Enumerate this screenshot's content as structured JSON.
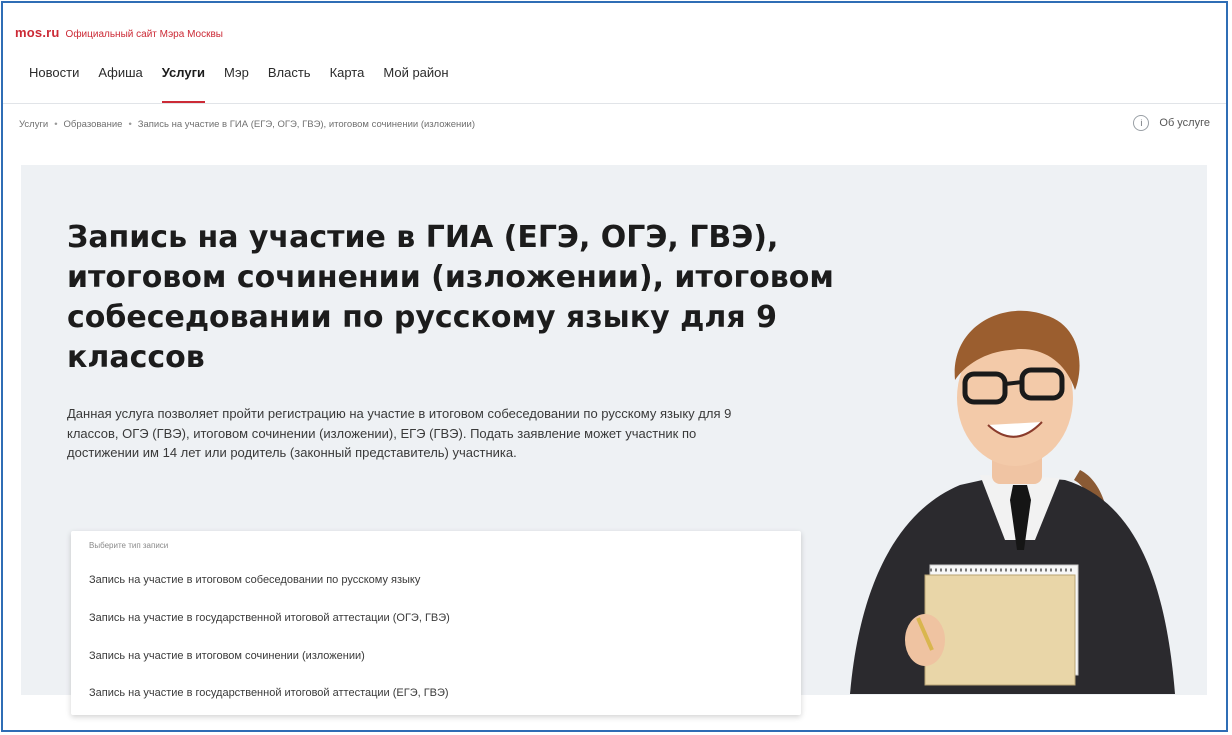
{
  "header": {
    "logo": "mos.ru",
    "tagline": "Официальный сайт Мэра Москвы",
    "nav": [
      {
        "label": "Новости"
      },
      {
        "label": "Афиша"
      },
      {
        "label": "Услуги",
        "active": true
      },
      {
        "label": "Мэр"
      },
      {
        "label": "Власть"
      },
      {
        "label": "Карта"
      },
      {
        "label": "Мой район"
      }
    ]
  },
  "breadcrumb": [
    "Услуги",
    "Образование",
    "Запись на участие в ГИА (ЕГЭ, ОГЭ, ГВЭ), итоговом сочинении (изложении)"
  ],
  "about_label": "Об услуге",
  "about_icon": "info-icon",
  "hero": {
    "title": "Запись на участие в ГИА (ЕГЭ, ОГЭ, ГВЭ), итоговом сочинении (изложении), итоговом собеседовании по русскому языку для 9 классов",
    "description": "Данная услуга позволяет пройти регистрацию на участие в итоговом собеседовании по русскому языку для 9 классов, ОГЭ (ГВЭ), итоговом сочинении (изложении), ЕГЭ (ГВЭ). Подать заявление может участник по достижении им 14 лет или родитель (законный представитель) участника."
  },
  "dropdown": {
    "label": "Выберите тип записи",
    "options": [
      "Запись на участие в итоговом собеседовании по русскому языку",
      "Запись на участие в государственной итоговой аттестации (ОГЭ, ГВЭ)",
      "Запись на участие в итоговом сочинении (изложении)",
      "Запись на участие в государственной итоговой аттестации (ЕГЭ, ГВЭ)"
    ]
  },
  "colors": {
    "brand": "#cc2a36",
    "hero_bg": "#eef1f4",
    "frame": "#2f6db5"
  }
}
